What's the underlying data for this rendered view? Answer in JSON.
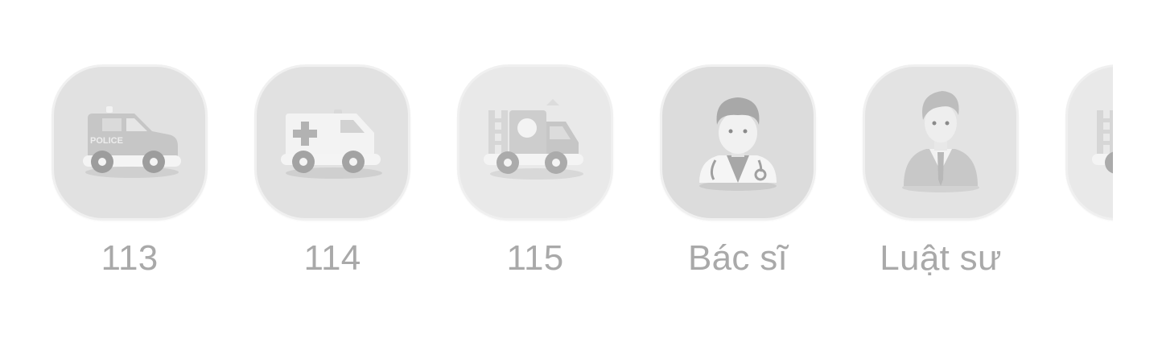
{
  "contacts": [
    {
      "label": "113",
      "icon": "police-car-icon",
      "tile_color": "#e1e1e1"
    },
    {
      "label": "114",
      "icon": "ambulance-icon",
      "tile_color": "#e1e1e1"
    },
    {
      "label": "115",
      "icon": "fire-truck-icon",
      "tile_color": "#e9e9e9"
    },
    {
      "label": "Bác sĩ",
      "icon": "doctor-icon",
      "tile_color": "#dcdcdc"
    },
    {
      "label": "Luật sư",
      "icon": "lawyer-icon",
      "tile_color": "#e3e3e3"
    },
    {
      "label": "",
      "icon": "fire-truck-icon",
      "tile_color": "#e9e9e9"
    }
  ],
  "police_text": "POLICE"
}
